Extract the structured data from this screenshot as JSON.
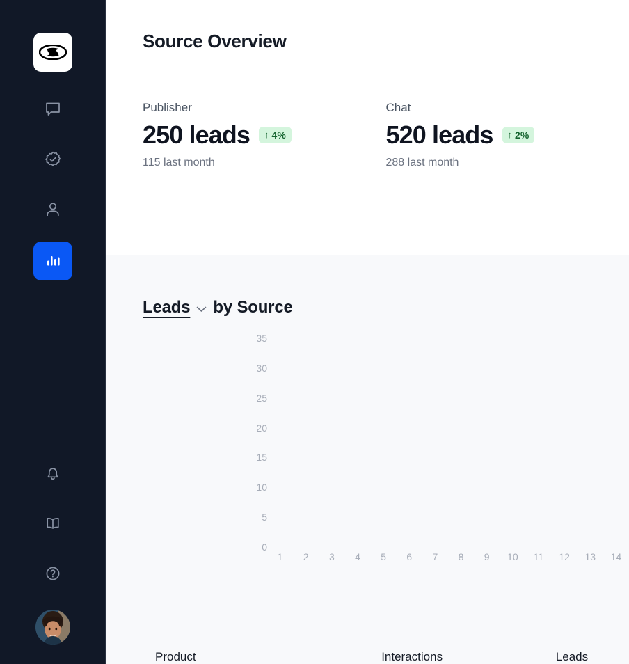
{
  "sidebar": {
    "logo": {
      "name": "hyundai-logo",
      "alt": "Hyundai"
    },
    "top_items": [
      {
        "icon": "chat-icon",
        "label": "Chat",
        "active": false
      },
      {
        "icon": "verified-badge-icon",
        "label": "Verified",
        "active": false
      },
      {
        "icon": "person-icon",
        "label": "Contacts",
        "active": false
      },
      {
        "icon": "bar-chart-icon",
        "label": "Analytics",
        "active": true
      }
    ],
    "bottom_items": [
      {
        "icon": "bell-icon",
        "label": "Notifications"
      },
      {
        "icon": "book-icon",
        "label": "Library"
      },
      {
        "icon": "help-circle-icon",
        "label": "Help"
      }
    ],
    "avatar": {
      "name": "user-avatar",
      "label": "User profile"
    },
    "accent_color": "#0a58f5",
    "background_color": "#111827"
  },
  "header": {
    "title": "Source Overview"
  },
  "stats": [
    {
      "label": "Publisher",
      "value": "250 leads",
      "badge": {
        "arrow": "↑",
        "text": "4%",
        "direction": "up"
      },
      "sub": "115 last month"
    },
    {
      "label": "Chat",
      "value": "520 leads",
      "badge": {
        "arrow": "↑",
        "text": "2%",
        "direction": "up"
      },
      "sub": "288 last month"
    }
  ],
  "chart_section": {
    "metric_label": "Leads",
    "suffix_label": "by Source",
    "dropdown_icon": "chevron-down-icon"
  },
  "chart_data": {
    "type": "bar",
    "title": "Leads by Source",
    "xlabel": "",
    "ylabel": "",
    "categories": [
      "1",
      "2",
      "3",
      "4",
      "5",
      "6",
      "7",
      "8",
      "9",
      "10",
      "11",
      "12",
      "13",
      "14"
    ],
    "values": [],
    "series": [],
    "yticks": [
      35,
      30,
      25,
      20,
      15,
      10,
      5,
      0
    ],
    "ytick_labels": [
      "35",
      "30",
      "25",
      "20",
      "15",
      "10",
      "5",
      "0"
    ],
    "ylim": [
      0,
      35
    ],
    "grid": false,
    "legend": "none",
    "empty_state": true
  },
  "table": {
    "columns": [
      {
        "key": "product",
        "label": "Product"
      },
      {
        "key": "interactions",
        "label": "Interactions"
      },
      {
        "key": "leads",
        "label": "Leads"
      }
    ],
    "rows": []
  },
  "colors": {
    "accent": "#0a58f5",
    "sidebar_bg": "#111827",
    "section_bg": "#f8f9fb",
    "badge_bg": "#d4f5dd",
    "badge_text": "#14632e",
    "text_primary": "#151b26",
    "text_muted": "#6b7280",
    "axis_text": "#a7adb8"
  }
}
